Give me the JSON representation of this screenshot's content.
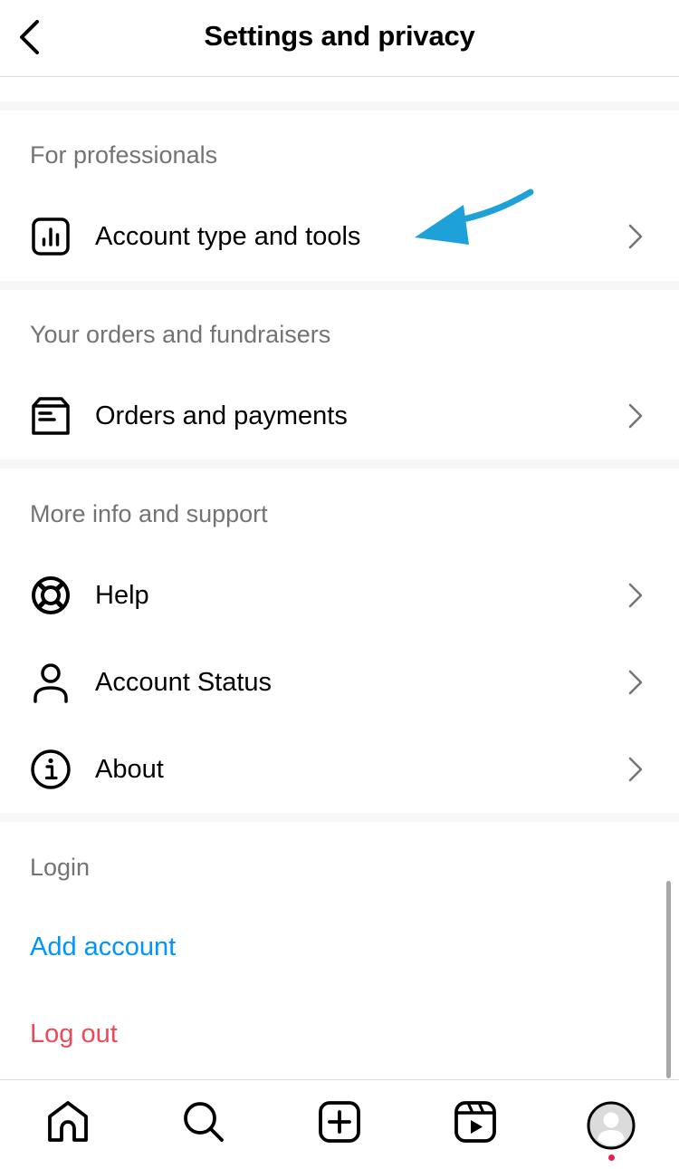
{
  "header": {
    "title": "Settings and privacy",
    "back_icon": "chevron-left-icon"
  },
  "sections": [
    {
      "label": "For professionals",
      "items": [
        {
          "label": "Account type and tools",
          "icon": "bar-chart-icon"
        }
      ]
    },
    {
      "label": "Your orders and fundraisers",
      "items": [
        {
          "label": "Orders and payments",
          "icon": "package-icon"
        }
      ]
    },
    {
      "label": "More info and support",
      "items": [
        {
          "label": "Help",
          "icon": "lifebuoy-icon"
        },
        {
          "label": "Account Status",
          "icon": "person-icon"
        },
        {
          "label": "About",
          "icon": "info-icon"
        }
      ]
    },
    {
      "label": "Login",
      "links": [
        {
          "label": "Add account",
          "color": "#0095f6"
        },
        {
          "label": "Log out",
          "color": "#ed4956"
        }
      ]
    }
  ],
  "annotation": {
    "type": "arrow",
    "color": "#1da1d8",
    "points_to": "Account type and tools"
  },
  "tabbar": {
    "tabs": [
      {
        "name": "home",
        "icon": "home-icon"
      },
      {
        "name": "search",
        "icon": "search-icon"
      },
      {
        "name": "create",
        "icon": "plus-square-icon"
      },
      {
        "name": "reels",
        "icon": "reels-icon"
      },
      {
        "name": "profile",
        "icon": "avatar-icon",
        "has_notification_dot": true
      }
    ]
  },
  "colors": {
    "link_blue": "#0095f6",
    "logout_red": "#ed4956",
    "section_label": "#737373",
    "notification_dot": "#ed1d50"
  }
}
